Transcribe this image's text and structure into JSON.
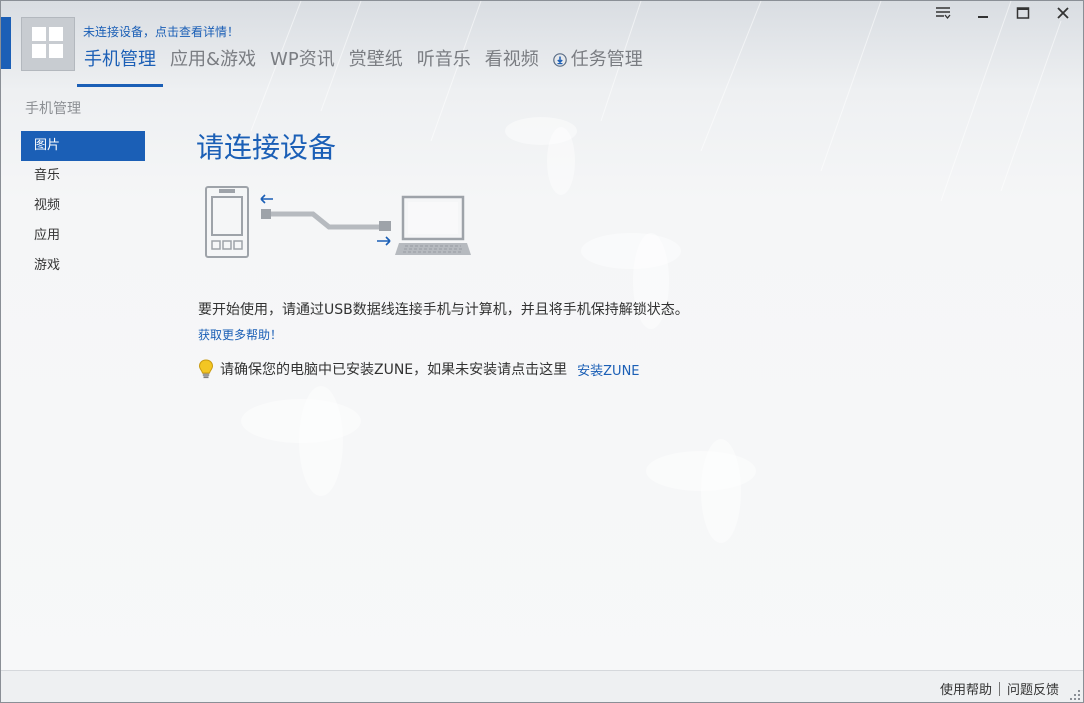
{
  "header": {
    "status_link": "未连接设备，点击查看详情！",
    "nav": [
      {
        "label": "手机管理",
        "active": true
      },
      {
        "label": "应用&游戏",
        "active": false
      },
      {
        "label": "WP资讯",
        "active": false
      },
      {
        "label": "赏壁纸",
        "active": false
      },
      {
        "label": "听音乐",
        "active": false
      },
      {
        "label": "看视频",
        "active": false
      },
      {
        "label": "任务管理",
        "active": false,
        "icon": "download-icon"
      }
    ]
  },
  "window_controls": [
    "menu-icon",
    "minimize-icon",
    "maximize-icon",
    "close-icon"
  ],
  "sidebar": {
    "title": "手机管理",
    "items": [
      {
        "label": "图片",
        "active": true
      },
      {
        "label": "音乐",
        "active": false
      },
      {
        "label": "视频",
        "active": false
      },
      {
        "label": "应用",
        "active": false
      },
      {
        "label": "游戏",
        "active": false
      }
    ]
  },
  "main": {
    "title": "请连接设备",
    "instruction": "要开始使用，请通过USB数据线连接手机与计算机，并且将手机保持解锁状态。",
    "help_link": "获取更多帮助！",
    "tip_text": "请确保您的电脑中已安装ZUNE，如果未安装请点击这里",
    "zune_link": "安装ZUNE"
  },
  "footer": {
    "help": "使用帮助",
    "feedback": "问题反馈"
  },
  "colors": {
    "accent": "#1b5fb6",
    "text": "#333333",
    "muted": "#7a7d82"
  }
}
